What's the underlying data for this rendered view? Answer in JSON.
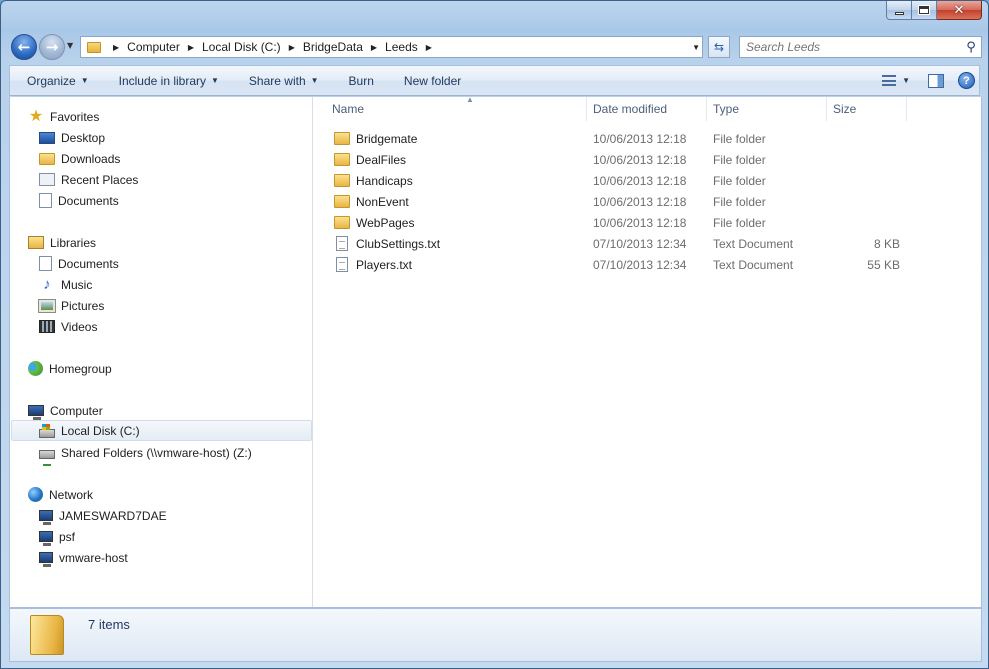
{
  "window": {
    "caption": {
      "close": "✕"
    }
  },
  "address_bar": {
    "crumbs": [
      "Computer",
      "Local Disk (C:)",
      "BridgeData",
      "Leeds"
    ],
    "search_placeholder": "Search Leeds"
  },
  "toolbar": {
    "organize": "Organize",
    "include_in_library": "Include in library",
    "share_with": "Share with",
    "burn": "Burn",
    "new_folder": "New folder"
  },
  "nav": {
    "favorites": "Favorites",
    "desktop": "Desktop",
    "downloads": "Downloads",
    "recent_places": "Recent Places",
    "fav_documents": "Documents",
    "libraries": "Libraries",
    "lib_documents": "Documents",
    "music": "Music",
    "pictures": "Pictures",
    "videos": "Videos",
    "homegroup": "Homegroup",
    "computer": "Computer",
    "local_disk": "Local Disk (C:)",
    "shared_folders": "Shared Folders (\\\\vmware-host) (Z:)",
    "network": "Network",
    "net_1": "JAMESWARD7DAE",
    "net_2": "psf",
    "net_3": "vmware-host"
  },
  "columns": {
    "name": "Name",
    "date_modified": "Date modified",
    "type": "Type",
    "size": "Size"
  },
  "files": [
    {
      "name": "Bridgemate",
      "date": "10/06/2013 12:18",
      "type": "File folder",
      "size": "",
      "icon": "folder-icon"
    },
    {
      "name": "DealFiles",
      "date": "10/06/2013 12:18",
      "type": "File folder",
      "size": "",
      "icon": "folder-icon"
    },
    {
      "name": "Handicaps",
      "date": "10/06/2013 12:18",
      "type": "File folder",
      "size": "",
      "icon": "folder-icon"
    },
    {
      "name": "NonEvent",
      "date": "10/06/2013 12:18",
      "type": "File folder",
      "size": "",
      "icon": "folder-icon"
    },
    {
      "name": "WebPages",
      "date": "10/06/2013 12:18",
      "type": "File folder",
      "size": "",
      "icon": "folder-icon"
    },
    {
      "name": "ClubSettings.txt",
      "date": "07/10/2013 12:34",
      "type": "Text Document",
      "size": "8 KB",
      "icon": "text-file-icon"
    },
    {
      "name": "Players.txt",
      "date": "07/10/2013 12:34",
      "type": "Text Document",
      "size": "55 KB",
      "icon": "text-file-icon"
    }
  ],
  "status": {
    "item_count": "7 items"
  }
}
